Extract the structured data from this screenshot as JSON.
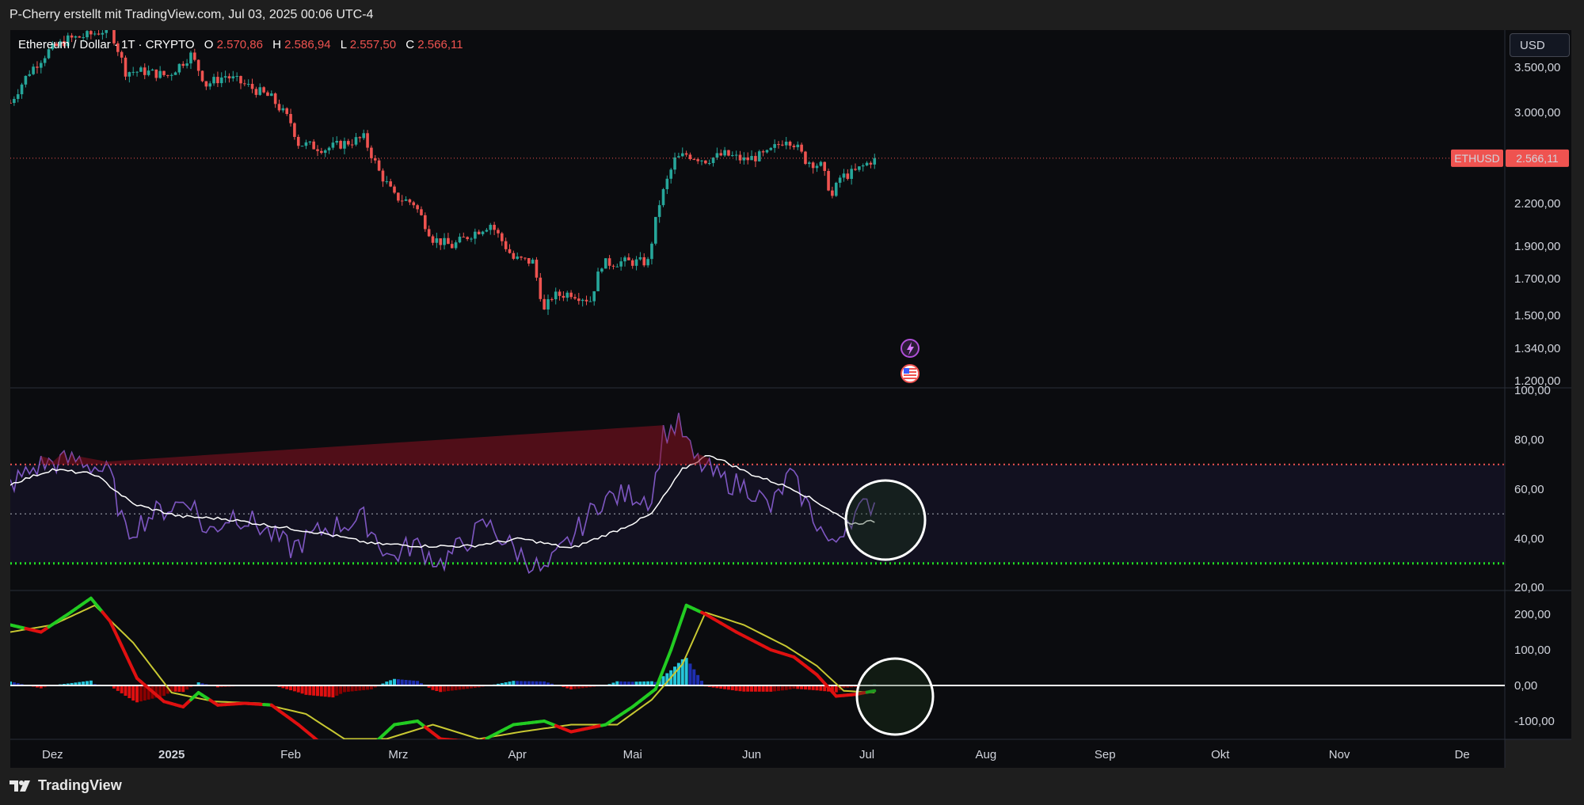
{
  "header": {
    "caption": "P-Cherry erstellt mit TradingView.com, Jul 03, 2025 00:06 UTC-4"
  },
  "legend": {
    "symbol": "Ethereum / Dollar · 1T · CRYPTO",
    "o_label": "O",
    "o_value": "2.570,86",
    "h_label": "H",
    "h_value": "2.586,94",
    "l_label": "L",
    "l_value": "2.557,50",
    "c_label": "C",
    "c_value": "2.566,11"
  },
  "currency_button": "USD",
  "price_tag": {
    "symbol": "ETHUSD",
    "value": "2.566,11"
  },
  "footer": {
    "brand": "TradingView"
  },
  "colors": {
    "background": "#0b0c0f",
    "up": "#26a69a",
    "down": "#ef5350",
    "rsi_line": "#7e57c2",
    "rsi_ma": "#ffffff",
    "overbought": "#ef5350",
    "oversold": "#22dd22",
    "macd_up": "#22cc22",
    "macd_down": "#e01010",
    "signal": "#c8c832",
    "hist_pos_strong": "#26c6da",
    "hist_pos_weak": "#1e2fb0",
    "hist_neg_strong": "#e01010",
    "hist_neg_weak": "#8b0000"
  },
  "icons": [
    "lightning-event-icon",
    "us-flag-event-icon",
    "tradingview-logo-icon"
  ],
  "chart_data": [
    {
      "type": "candlestick",
      "title": "Ethereum / Dollar · 1T · CRYPTO",
      "x_labels": [
        "Dez",
        "2025",
        "Feb",
        "Mrz",
        "Apr",
        "Mai",
        "Jun",
        "Jul",
        "Aug",
        "Sep",
        "Okt",
        "Nov",
        "De"
      ],
      "y_ticks": [
        "3.500,00",
        "3.000,00",
        "2.200,00",
        "1.900,00",
        "1.700,00",
        "1.500,00",
        "1.340,00",
        "1.200,00"
      ],
      "y_tick_values": [
        3500,
        3000,
        2200,
        1900,
        1700,
        1500,
        1340,
        1200
      ],
      "y_scale": "log",
      "last_price": 2566.11,
      "anchor_prices": [
        [
          "2024-11-20",
          3100
        ],
        [
          "2024-11-25",
          3450
        ],
        [
          "2024-11-30",
          3700
        ],
        [
          "2024-12-05",
          3850
        ],
        [
          "2024-12-10",
          3900
        ],
        [
          "2024-12-16",
          4000
        ],
        [
          "2024-12-20",
          3450
        ],
        [
          "2024-12-25",
          3450
        ],
        [
          "2024-12-31",
          3400
        ],
        [
          "2025-01-06",
          3650
        ],
        [
          "2025-01-10",
          3300
        ],
        [
          "2025-01-15",
          3400
        ],
        [
          "2025-01-20",
          3300
        ],
        [
          "2025-01-27",
          3150
        ],
        [
          "2025-02-01",
          2900
        ],
        [
          "2025-02-03",
          2700
        ],
        [
          "2025-02-10",
          2650
        ],
        [
          "2025-02-15",
          2700
        ],
        [
          "2025-02-20",
          2750
        ],
        [
          "2025-02-24",
          2450
        ],
        [
          "2025-02-28",
          2250
        ],
        [
          "2025-03-05",
          2200
        ],
        [
          "2025-03-10",
          1950
        ],
        [
          "2025-03-15",
          1900
        ],
        [
          "2025-03-20",
          1980
        ],
        [
          "2025-03-25",
          2050
        ],
        [
          "2025-03-31",
          1820
        ],
        [
          "2025-04-05",
          1800
        ],
        [
          "2025-04-08",
          1520
        ],
        [
          "2025-04-10",
          1600
        ],
        [
          "2025-04-15",
          1620
        ],
        [
          "2025-04-20",
          1580
        ],
        [
          "2025-04-23",
          1790
        ],
        [
          "2025-04-28",
          1800
        ],
        [
          "2025-05-05",
          1800
        ],
        [
          "2025-05-08",
          2200
        ],
        [
          "2025-05-12",
          2550
        ],
        [
          "2025-05-15",
          2600
        ],
        [
          "2025-05-20",
          2550
        ],
        [
          "2025-05-25",
          2600
        ],
        [
          "2025-05-30",
          2550
        ],
        [
          "2025-06-05",
          2600
        ],
        [
          "2025-06-10",
          2750
        ],
        [
          "2025-06-12",
          2700
        ],
        [
          "2025-06-15",
          2550
        ],
        [
          "2025-06-19",
          2500
        ],
        [
          "2025-06-22",
          2250
        ],
        [
          "2025-06-24",
          2400
        ],
        [
          "2025-06-28",
          2450
        ],
        [
          "2025-07-03",
          2566
        ]
      ]
    },
    {
      "type": "line",
      "title": "",
      "y_ticks": [
        "100,00",
        "80,00",
        "60,00",
        "40,00",
        "20,00"
      ],
      "y_tick_values": [
        100,
        80,
        60,
        40,
        20
      ],
      "ylim": [
        20,
        100
      ],
      "levels": {
        "overbought": 70,
        "middle": 50,
        "oversold": 30
      },
      "series": [
        {
          "values_anchor": [
            [
              "2024-11-20",
              62
            ],
            [
              "2024-11-28",
              70
            ],
            [
              "2024-12-08",
              72
            ],
            [
              "2024-12-16",
              66
            ],
            [
              "2024-12-20",
              42
            ],
            [
              "2024-12-27",
              50
            ],
            [
              "2025-01-06",
              56
            ],
            [
              "2025-01-10",
              42
            ],
            [
              "2025-01-17",
              50
            ],
            [
              "2025-01-23",
              46
            ],
            [
              "2025-02-01",
              36
            ],
            [
              "2025-02-10",
              44
            ],
            [
              "2025-02-20",
              48
            ],
            [
              "2025-02-27",
              32
            ],
            [
              "2025-03-05",
              38
            ],
            [
              "2025-03-12",
              30
            ],
            [
              "2025-03-24",
              46
            ],
            [
              "2025-03-31",
              36
            ],
            [
              "2025-04-08",
              26
            ],
            [
              "2025-04-15",
              40
            ],
            [
              "2025-04-23",
              56
            ],
            [
              "2025-05-01",
              58
            ],
            [
              "2025-05-06",
              56
            ],
            [
              "2025-05-09",
              82
            ],
            [
              "2025-05-13",
              86
            ],
            [
              "2025-05-17",
              72
            ],
            [
              "2025-05-24",
              64
            ],
            [
              "2025-06-01",
              60
            ],
            [
              "2025-06-06",
              52
            ],
            [
              "2025-06-11",
              66
            ],
            [
              "2025-06-16",
              52
            ],
            [
              "2025-06-22",
              36
            ],
            [
              "2025-06-26",
              48
            ],
            [
              "2025-06-30",
              52
            ],
            [
              "2025-07-03",
              55
            ]
          ]
        },
        {
          "values_anchor": [
            [
              "2024-11-20",
              62
            ],
            [
              "2024-12-01",
              68
            ],
            [
              "2024-12-12",
              66
            ],
            [
              "2024-12-22",
              54
            ],
            [
              "2025-01-03",
              49
            ],
            [
              "2025-01-15",
              48
            ],
            [
              "2025-01-28",
              45
            ],
            [
              "2025-02-10",
              42
            ],
            [
              "2025-02-22",
              38
            ],
            [
              "2025-03-08",
              37
            ],
            [
              "2025-03-20",
              37
            ],
            [
              "2025-04-02",
              40
            ],
            [
              "2025-04-15",
              36
            ],
            [
              "2025-04-28",
              44
            ],
            [
              "2025-05-06",
              50
            ],
            [
              "2025-05-14",
              68
            ],
            [
              "2025-05-21",
              74
            ],
            [
              "2025-06-01",
              66
            ],
            [
              "2025-06-12",
              60
            ],
            [
              "2025-06-20",
              53
            ],
            [
              "2025-06-27",
              46
            ],
            [
              "2025-07-03",
              47
            ]
          ]
        }
      ]
    },
    {
      "type": "line",
      "title": "",
      "y_ticks": [
        "200,00",
        "100,00",
        "0,00",
        "-100,00"
      ],
      "y_tick_values": [
        200,
        100,
        0,
        -100
      ],
      "ylim": [
        -145,
        255
      ],
      "series": [
        {
          "values_anchor": [
            [
              "2024-11-20",
              170
            ],
            [
              "2024-11-28",
              150
            ],
            [
              "2024-12-05",
              200
            ],
            [
              "2024-12-11",
              245
            ],
            [
              "2024-12-16",
              180
            ],
            [
              "2024-12-23",
              20
            ],
            [
              "2024-12-30",
              -45
            ],
            [
              "2025-01-04",
              -60
            ],
            [
              "2025-01-08",
              -20
            ],
            [
              "2025-01-13",
              -55
            ],
            [
              "2025-01-20",
              -50
            ],
            [
              "2025-01-27",
              -55
            ],
            [
              "2025-02-03",
              -110
            ],
            [
              "2025-02-12",
              -190
            ],
            [
              "2025-02-22",
              -170
            ],
            [
              "2025-02-28",
              -110
            ],
            [
              "2025-03-06",
              -100
            ],
            [
              "2025-03-12",
              -150
            ],
            [
              "2025-03-22",
              -160
            ],
            [
              "2025-03-31",
              -110
            ],
            [
              "2025-04-08",
              -100
            ],
            [
              "2025-04-15",
              -130
            ],
            [
              "2025-04-24",
              -110
            ],
            [
              "2025-05-01",
              -60
            ],
            [
              "2025-05-07",
              -10
            ],
            [
              "2025-05-11",
              100
            ],
            [
              "2025-05-15",
              225
            ],
            [
              "2025-05-20",
              200
            ],
            [
              "2025-05-28",
              150
            ],
            [
              "2025-06-06",
              100
            ],
            [
              "2025-06-12",
              80
            ],
            [
              "2025-06-18",
              30
            ],
            [
              "2025-06-23",
              -30
            ],
            [
              "2025-06-28",
              -25
            ],
            [
              "2025-07-03",
              -15
            ]
          ]
        },
        {
          "values_anchor": [
            [
              "2024-11-20",
              150
            ],
            [
              "2024-12-01",
              170
            ],
            [
              "2024-12-12",
              225
            ],
            [
              "2024-12-22",
              120
            ],
            [
              "2025-01-01",
              -20
            ],
            [
              "2025-01-12",
              -45
            ],
            [
              "2025-01-24",
              -50
            ],
            [
              "2025-02-05",
              -80
            ],
            [
              "2025-02-15",
              -150
            ],
            [
              "2025-02-26",
              -150
            ],
            [
              "2025-03-10",
              -110
            ],
            [
              "2025-03-22",
              -150
            ],
            [
              "2025-04-02",
              -130
            ],
            [
              "2025-04-15",
              -110
            ],
            [
              "2025-04-27",
              -110
            ],
            [
              "2025-05-06",
              -40
            ],
            [
              "2025-05-14",
              60
            ],
            [
              "2025-05-20",
              205
            ],
            [
              "2025-05-30",
              170
            ],
            [
              "2025-06-10",
              110
            ],
            [
              "2025-06-18",
              55
            ],
            [
              "2025-06-25",
              -15
            ],
            [
              "2025-07-03",
              -20
            ]
          ]
        }
      ]
    }
  ]
}
